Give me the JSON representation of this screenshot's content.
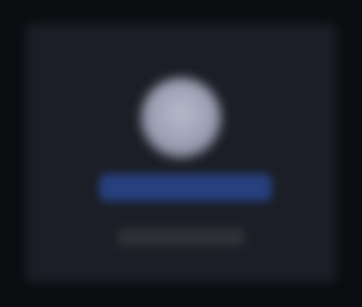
{
  "profile": {
    "avatar_icon": "user-avatar-icon",
    "primary_action": "",
    "secondary_text": ""
  },
  "colors": {
    "background": "#0c0d11",
    "card": "#1b1e26",
    "avatar": "#a9acbf",
    "primary_button": "#27407f",
    "secondary_bar": "#2f3136"
  }
}
